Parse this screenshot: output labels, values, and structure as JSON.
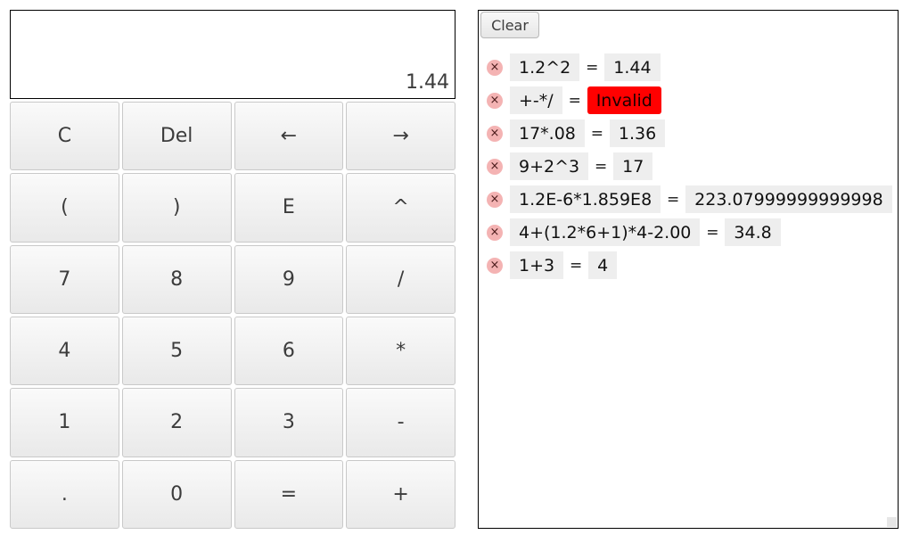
{
  "display": {
    "value": "1.44"
  },
  "keypad": {
    "rows": [
      [
        {
          "name": "clear-key",
          "label": "C"
        },
        {
          "name": "delete-key",
          "label": "Del"
        },
        {
          "name": "cursor-left-key",
          "label": "←"
        },
        {
          "name": "cursor-right-key",
          "label": "→"
        }
      ],
      [
        {
          "name": "open-paren-key",
          "label": "("
        },
        {
          "name": "close-paren-key",
          "label": ")"
        },
        {
          "name": "exponent-e-key",
          "label": "E"
        },
        {
          "name": "power-key",
          "label": "^"
        }
      ],
      [
        {
          "name": "digit-7-key",
          "label": "7"
        },
        {
          "name": "digit-8-key",
          "label": "8"
        },
        {
          "name": "digit-9-key",
          "label": "9"
        },
        {
          "name": "divide-key",
          "label": "/"
        }
      ],
      [
        {
          "name": "digit-4-key",
          "label": "4"
        },
        {
          "name": "digit-5-key",
          "label": "5"
        },
        {
          "name": "digit-6-key",
          "label": "6"
        },
        {
          "name": "multiply-key",
          "label": "*"
        }
      ],
      [
        {
          "name": "digit-1-key",
          "label": "1"
        },
        {
          "name": "digit-2-key",
          "label": "2"
        },
        {
          "name": "digit-3-key",
          "label": "3"
        },
        {
          "name": "subtract-key",
          "label": "-"
        }
      ],
      [
        {
          "name": "decimal-point-key",
          "label": "."
        },
        {
          "name": "digit-0-key",
          "label": "0"
        },
        {
          "name": "equals-key",
          "label": "="
        },
        {
          "name": "add-key",
          "label": "+"
        }
      ]
    ]
  },
  "history": {
    "clear_label": "Clear",
    "delete_icon": "close-circle-icon",
    "equals_sign": "=",
    "entries": [
      {
        "expression": "1.2^2",
        "result": "1.44",
        "invalid": false
      },
      {
        "expression": "+-*/",
        "result": "Invalid",
        "invalid": true
      },
      {
        "expression": "17*.08",
        "result": "1.36",
        "invalid": false
      },
      {
        "expression": "9+2^3",
        "result": "17",
        "invalid": false
      },
      {
        "expression": "1.2E-6*1.859E8",
        "result": "223.07999999999998",
        "invalid": false
      },
      {
        "expression": "4+(1.2*6+1)*4-2.00",
        "result": "34.8",
        "invalid": false
      },
      {
        "expression": "1+3",
        "result": "4",
        "invalid": false
      }
    ]
  },
  "colors": {
    "invalid": "#ff0000",
    "chip": "#eeeeee",
    "delete_badge": "#f4b3b3"
  }
}
